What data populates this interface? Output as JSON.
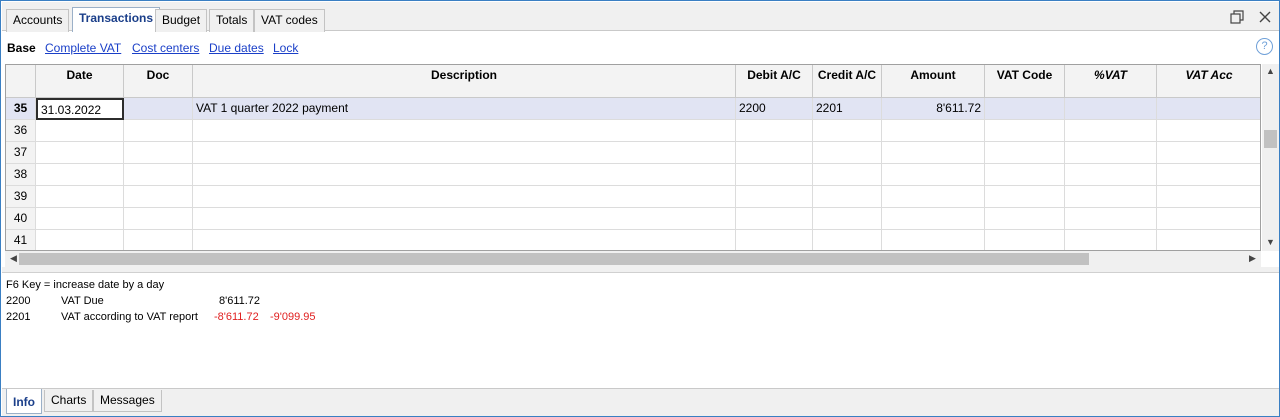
{
  "tabs": [
    {
      "label": "Accounts"
    },
    {
      "label": "Transactions"
    },
    {
      "label": "Budget"
    },
    {
      "label": "Totals"
    },
    {
      "label": "VAT codes"
    }
  ],
  "views": {
    "base": "Base",
    "complete_vat": "Complete VAT",
    "cost_centers": "Cost centers",
    "due_dates": "Due dates",
    "lock": "Lock"
  },
  "help_icon": "?",
  "columns": [
    "Date",
    "Doc",
    "Description",
    "Debit A/C",
    "Credit A/C",
    "Amount",
    "VAT Code",
    "%VAT",
    "VAT Acc"
  ],
  "rows": [
    {
      "n": "35",
      "date": "31.03.2022",
      "doc": "",
      "desc": "VAT 1 quarter 2022 payment",
      "debit": "2200",
      "credit": "2201",
      "amount": "8'611.72"
    },
    {
      "n": "36"
    },
    {
      "n": "37"
    },
    {
      "n": "38"
    },
    {
      "n": "39"
    },
    {
      "n": "40"
    },
    {
      "n": "41"
    }
  ],
  "info": {
    "hint": "F6 Key = increase date by a day",
    "lines": [
      {
        "account": "2200",
        "desc": "VAT Due",
        "amount1": "8'611.72",
        "amount2": ""
      },
      {
        "account": "2201",
        "desc": "VAT according to VAT report",
        "amount1": "-8'611.72",
        "amount2": "-9'099.95"
      }
    ]
  },
  "bottom_tabs": [
    {
      "label": "Info"
    },
    {
      "label": "Charts"
    },
    {
      "label": "Messages"
    }
  ],
  "colors": {
    "accent": "#1b3f8a",
    "link": "#1a3fc8",
    "negative": "#e02020",
    "selected_row": "#e1e4f3"
  }
}
